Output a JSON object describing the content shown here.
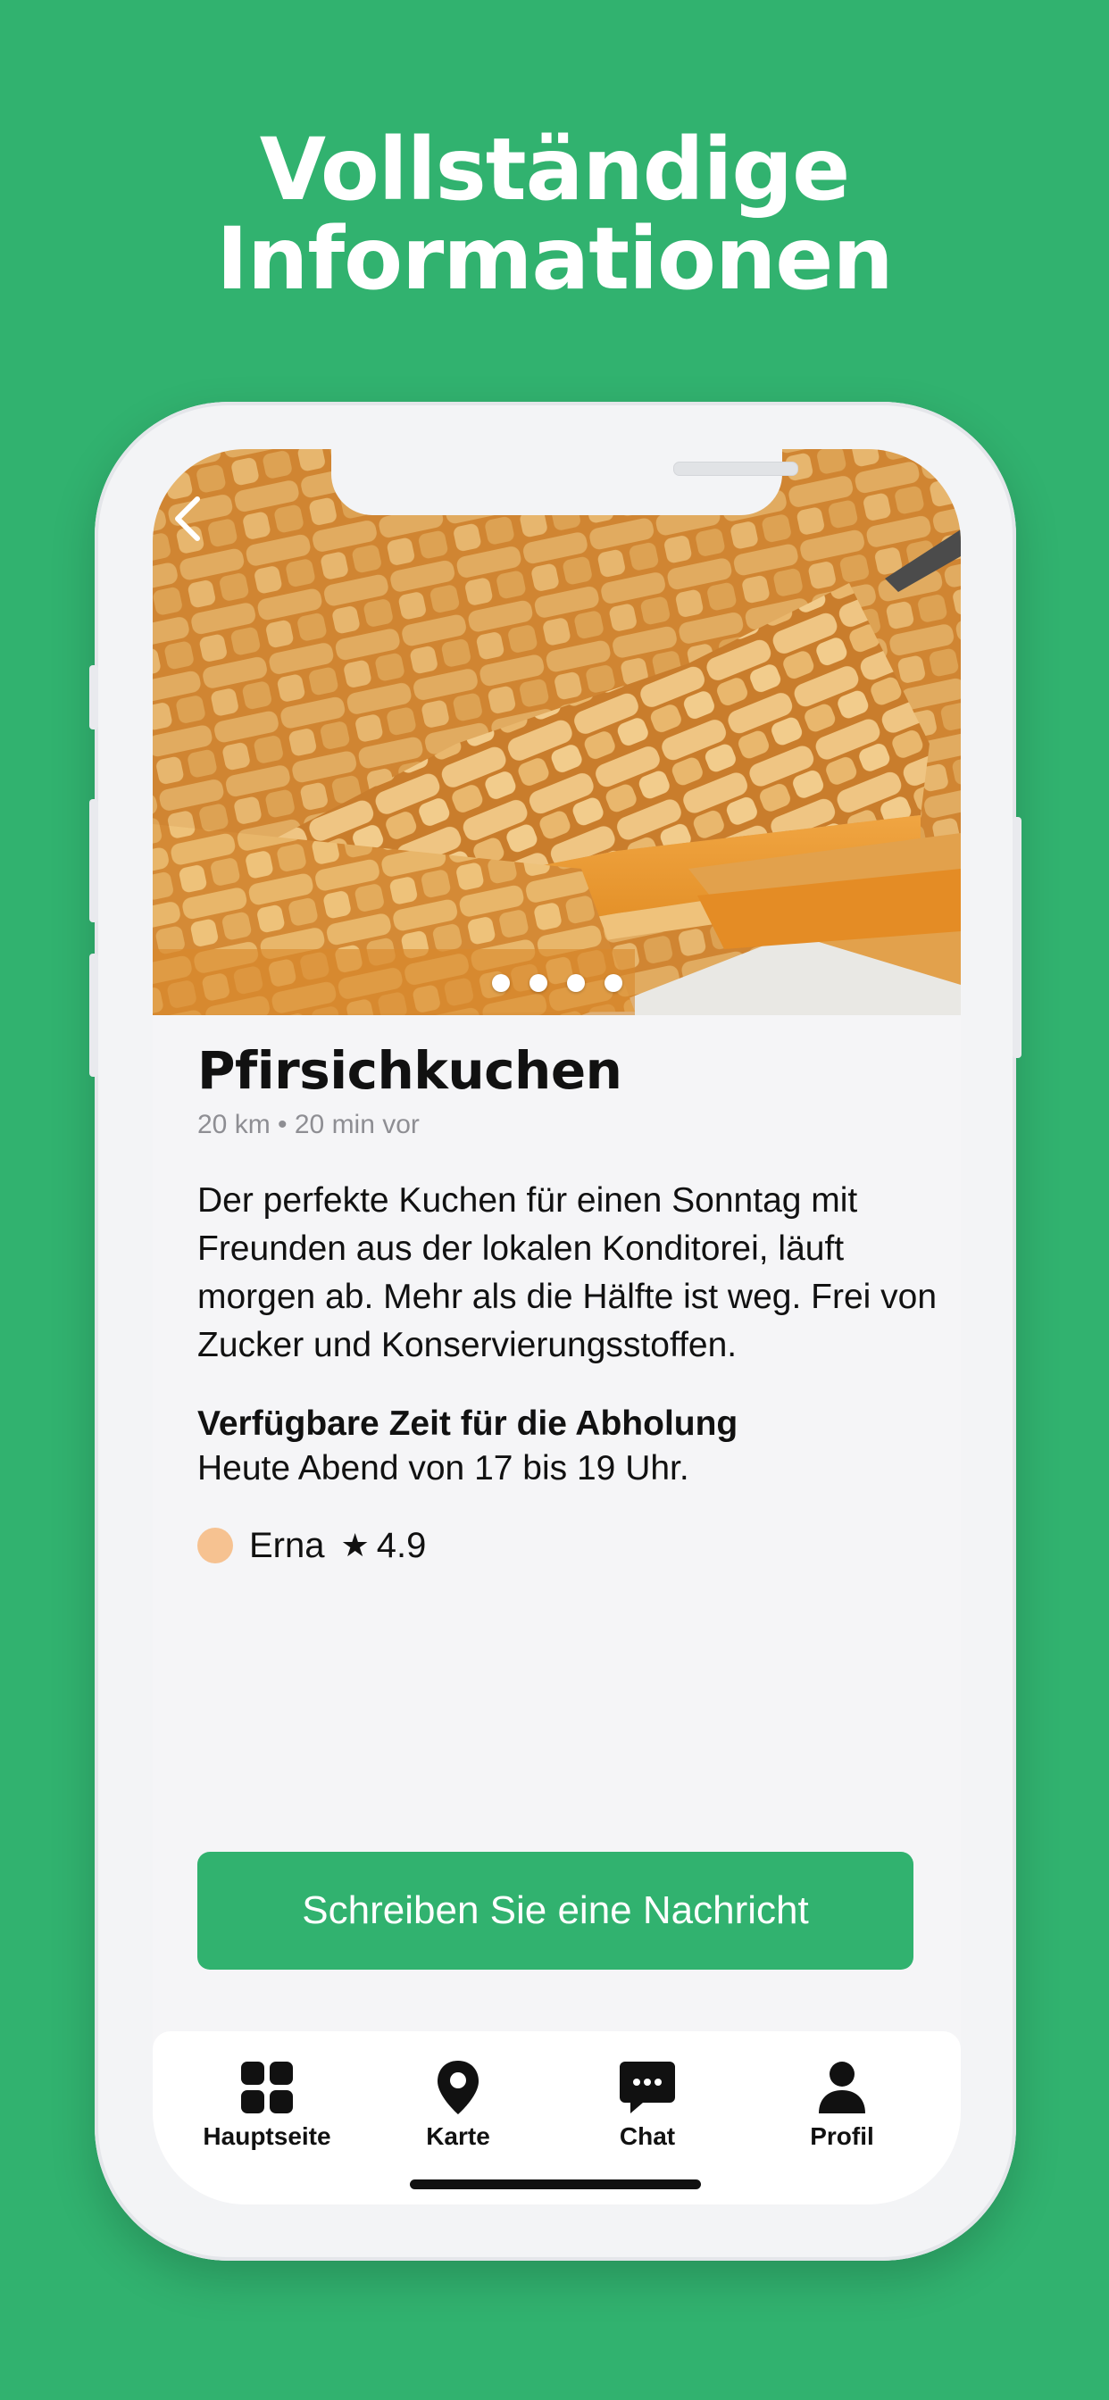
{
  "headline": {
    "line1": "Vollständige",
    "line2": "Informationen"
  },
  "listing": {
    "title": "Pfirsichkuchen",
    "meta": "20 km • 20 min vor",
    "description": "Der perfekte Kuchen für einen Sonntag mit Freunden aus der lokalen Konditorei, läuft morgen ab. Mehr als die Hälfte ist weg. Frei von Zucker und Konservierungsstoffen.",
    "pickup_title": "Verfügbare Zeit für die Abholung",
    "pickup_text": "Heute Abend von 17 bis 19 Uhr.",
    "user_name": "Erna",
    "rating": "4.9",
    "image_count": 4
  },
  "cta": {
    "label": "Schreiben Sie eine Nachricht"
  },
  "tabs": [
    {
      "label": "Hauptseite",
      "icon": "grid-icon"
    },
    {
      "label": "Karte",
      "icon": "map-pin-icon"
    },
    {
      "label": "Chat",
      "icon": "chat-bubble-icon"
    },
    {
      "label": "Profil",
      "icon": "person-icon"
    }
  ],
  "colors": {
    "brand": "#31b26f",
    "avatar": "#f6c291",
    "text": "#111111",
    "muted": "#8e8e93"
  }
}
